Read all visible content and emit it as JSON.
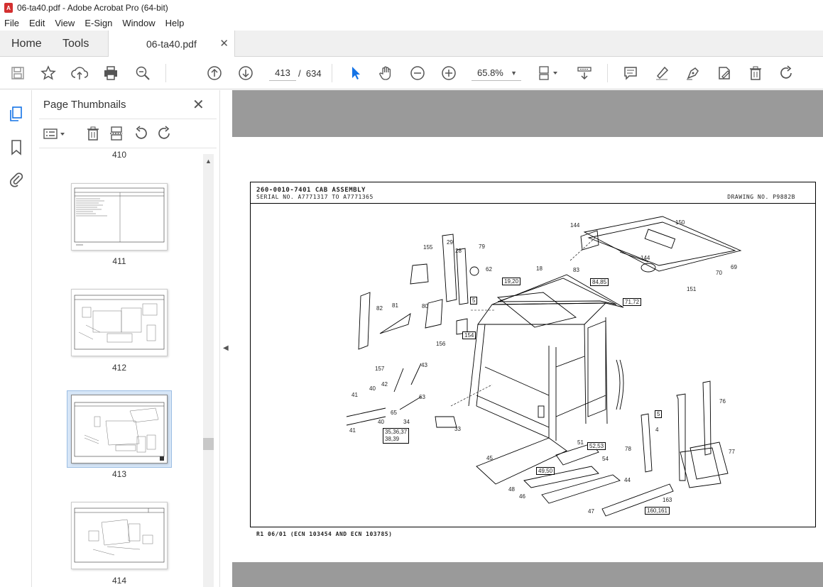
{
  "window": {
    "title": "06-ta40.pdf - Adobe Acrobat Pro (64-bit)",
    "app_icon": "pdf-icon"
  },
  "menu": [
    "File",
    "Edit",
    "View",
    "E-Sign",
    "Window",
    "Help"
  ],
  "tabs": {
    "home": "Home",
    "tools": "Tools",
    "document": "06-ta40.pdf"
  },
  "toolbar": {
    "current_page": "413",
    "page_sep": "/",
    "total_pages": "634",
    "zoom": "65.8%"
  },
  "thumbnails": {
    "header": "Page Thumbnails",
    "partial_label": "410",
    "items": [
      {
        "label": "411"
      },
      {
        "label": "412"
      },
      {
        "label": "413",
        "selected": true
      },
      {
        "label": "414"
      }
    ]
  },
  "drawing": {
    "title": "260-0010-7401 CAB ASSEMBLY",
    "serial": "SERIAL NO. A7771317 TO A7771365",
    "drawing_no": "DRAWING NO. P9882B",
    "revision": "R1 06/01 (ECN 103454 AND ECN 103785)",
    "callouts": [
      "144",
      "150",
      "155",
      "29",
      "28",
      "79",
      "62",
      "18",
      "19,20",
      "83",
      "84,85",
      "144",
      "70",
      "69",
      "151",
      "71,72",
      "82",
      "81",
      "80",
      "5",
      "156",
      "154",
      "157",
      "42",
      "43",
      "40",
      "41",
      "65",
      "40",
      "41",
      "63",
      "34",
      "33",
      "35,36,37",
      "38,39",
      "5",
      "4",
      "76",
      "78",
      "77",
      "51",
      "52,53",
      "45",
      "54",
      "49,50",
      "48",
      "46",
      "44",
      "163",
      "47",
      "160,161"
    ]
  },
  "colors": {
    "accent": "#1473e6",
    "viewer_bg": "#9a9a9a",
    "selected_thumb": "#d7e6f7"
  }
}
